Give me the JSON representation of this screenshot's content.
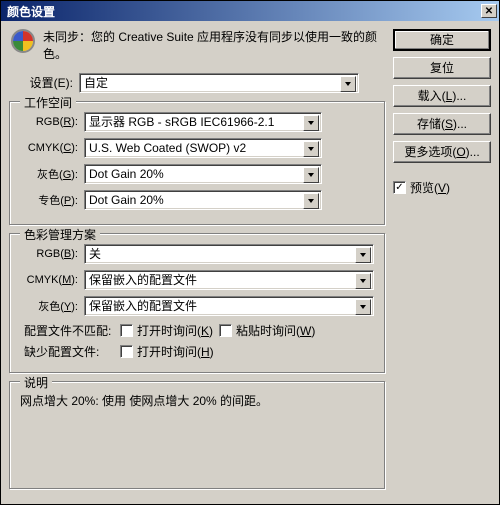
{
  "title": "颜色设置",
  "sync_message": "未同步：您的 Creative Suite 应用程序没有同步以使用一致的颜色。",
  "settings": {
    "label": "设置(E):",
    "value": "自定"
  },
  "workspace": {
    "title": "工作空间",
    "rgb": {
      "label": "RGB(R):",
      "value": "显示器 RGB - sRGB IEC61966-2.1"
    },
    "cmyk": {
      "label": "CMYK(C):",
      "value": "U.S. Web Coated (SWOP) v2"
    },
    "gray": {
      "label": "灰色(G):",
      "value": "Dot Gain 20%"
    },
    "spot": {
      "label": "专色(P):",
      "value": "Dot Gain 20%"
    }
  },
  "management": {
    "title": "色彩管理方案",
    "rgb": {
      "label": "RGB(B):",
      "value": "关"
    },
    "cmyk": {
      "label": "CMYK(M):",
      "value": "保留嵌入的配置文件"
    },
    "gray": {
      "label": "灰色(Y):",
      "value": "保留嵌入的配置文件"
    },
    "mismatch": {
      "label": "配置文件不匹配:",
      "ask_open": "打开时询问(K)",
      "ask_paste": "粘贴时询问(W)"
    },
    "missing": {
      "label": "缺少配置文件:",
      "ask_open": "打开时询问(H)"
    }
  },
  "description": {
    "title": "说明",
    "text": "网点增大 20%: 使用 使网点增大 20% 的间距。"
  },
  "buttons": {
    "ok": "确定",
    "reset": "复位",
    "load": "载入(L)...",
    "save": "存储(S)...",
    "more": "更多选项(O)..."
  },
  "preview": {
    "label": "预览(V)",
    "check": "✓"
  }
}
